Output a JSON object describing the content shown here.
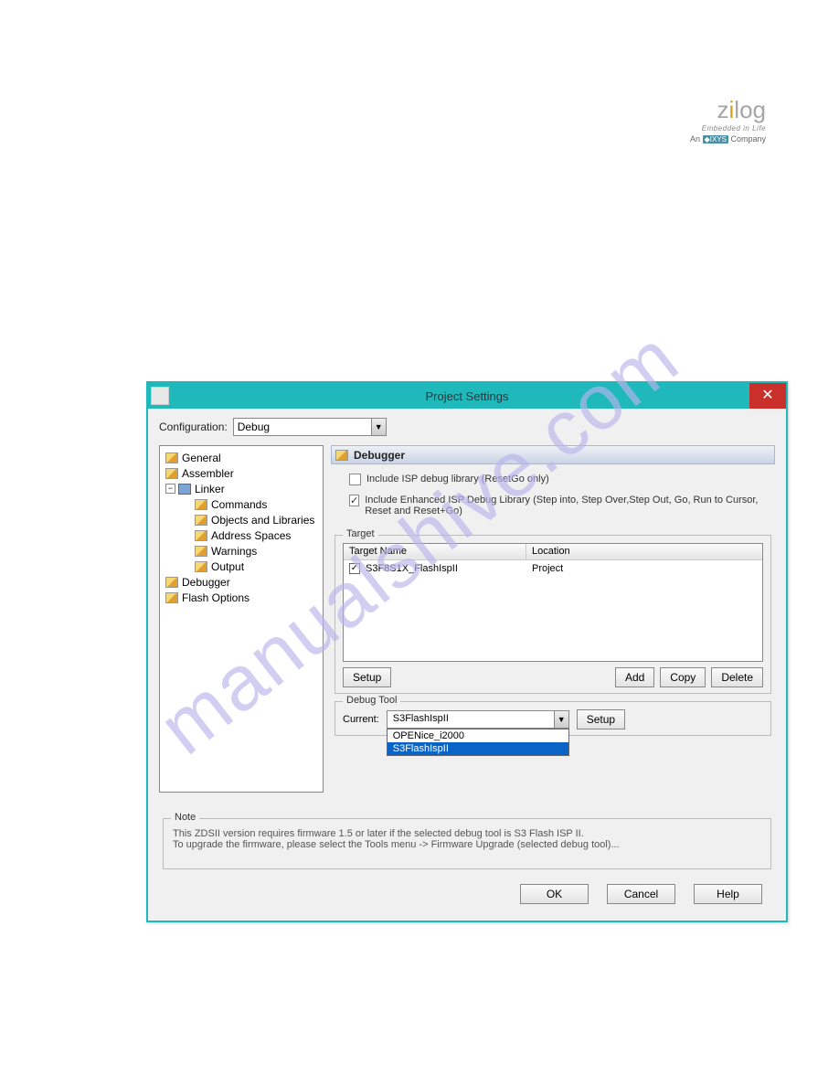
{
  "brand": {
    "name_part1": "z",
    "name_dot": "i",
    "name_part2": "log",
    "tagline": "Embedded in Life",
    "comp_pre": "An",
    "comp_chip": "◆IXYS",
    "comp_post": "Company"
  },
  "watermark": "manualshive.com",
  "dialog": {
    "title": "Project Settings",
    "close_glyph": "✕",
    "config_label": "Configuration:",
    "config_value": "Debug",
    "btn_ok": "OK",
    "btn_cancel": "Cancel",
    "btn_help": "Help"
  },
  "tree": {
    "general": "General",
    "assembler": "Assembler",
    "linker": "Linker",
    "commands": "Commands",
    "objects": "Objects and Libraries",
    "address": "Address Spaces",
    "warnings": "Warnings",
    "output": "Output",
    "debugger": "Debugger",
    "flash": "Flash Options"
  },
  "panel": {
    "title": "Debugger",
    "opt1": "Include ISP debug library (ResetGo only)",
    "opt2": "Include Enhanced ISP Debug Library (Step into, Step Over,Step Out, Go, Run to Cursor, Reset and Reset+Go)",
    "target_legend": "Target",
    "col_name": "Target Name",
    "col_loc": "Location",
    "target_row": {
      "name": "S3F8S1X_FlashIspII",
      "loc": "Project"
    },
    "btn_setup": "Setup",
    "btn_add": "Add",
    "btn_copy": "Copy",
    "btn_delete": "Delete",
    "debug_legend": "Debug Tool",
    "current_label": "Current:",
    "dbg_value": "S3FlashIspII",
    "dbg_opts": [
      "OPENice_i2000",
      "S3FlashIspII"
    ]
  },
  "note": {
    "legend": "Note",
    "line1": "This ZDSII version requires firmware 1.5 or later if the selected debug tool is  S3 Flash ISP II.",
    "line2": "To upgrade the firmware, please select the Tools menu -> Firmware Upgrade (selected debug tool)..."
  }
}
